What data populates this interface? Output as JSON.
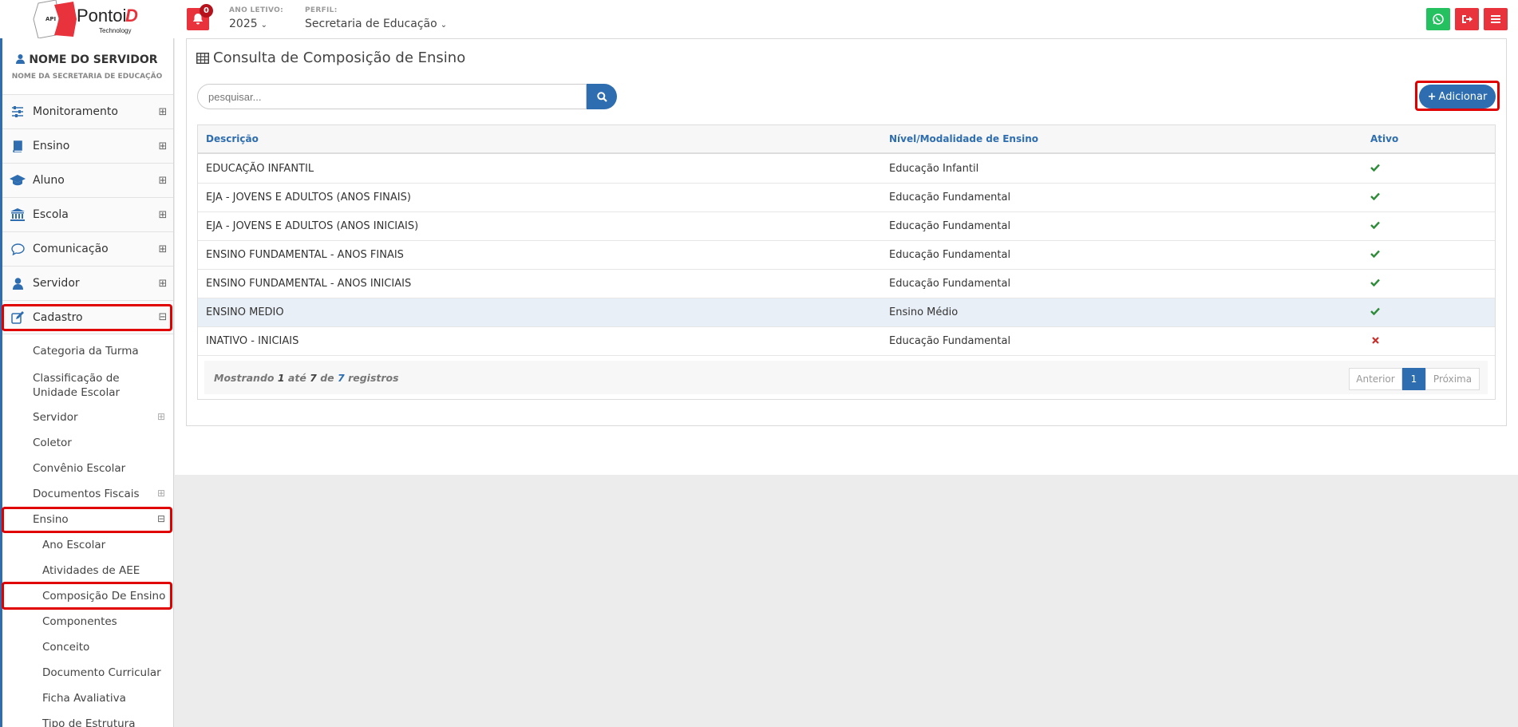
{
  "header": {
    "logo_text": "PontoiD",
    "logo_sub": "Technology",
    "logo_api": "API",
    "notifications_count": "0",
    "ano_letivo_label": "ANO LETIVO:",
    "ano_letivo_value": "2025",
    "perfil_label": "PERFIL:",
    "perfil_value": "Secretaria de Educação",
    "colors": {
      "whatsapp": "#25c160",
      "logout": "#e8323c",
      "menu": "#e8323c"
    }
  },
  "sidebar": {
    "user_name": "NOME DO SERVIDOR",
    "user_sub": "NOME DA SECRETARIA DE EDUCAÇÃO",
    "items": [
      {
        "label": "Monitoramento",
        "icon": "sliders-icon"
      },
      {
        "label": "Ensino",
        "icon": "book-icon"
      },
      {
        "label": "Aluno",
        "icon": "graduation-cap-icon"
      },
      {
        "label": "Escola",
        "icon": "institution-icon"
      },
      {
        "label": "Comunicação",
        "icon": "chat-bubble-icon"
      },
      {
        "label": "Servidor",
        "icon": "user-icon"
      },
      {
        "label": "Cadastro",
        "icon": "edit-icon"
      }
    ],
    "cadastro_sub": [
      "Categoria da Turma",
      "Classificação de Unidade Escolar",
      "Servidor",
      "Coletor",
      "Convênio Escolar",
      "Documentos Fiscais",
      "Ensino"
    ],
    "ensino_sub": [
      "Ano Escolar",
      "Atividades de AEE",
      "Composição De Ensino",
      "Componentes",
      "Conceito",
      "Documento Curricular",
      "Ficha Avaliativa",
      "Tipo de Estrutura"
    ]
  },
  "main": {
    "title": "Consulta de Composição de Ensino",
    "search_placeholder": "pesquisar...",
    "add_label": "Adicionar",
    "columns": [
      "Descrição",
      "Nível/Modalidade de Ensino",
      "Ativo"
    ],
    "rows": [
      {
        "descricao": "EDUCAÇÃO INFANTIL",
        "nivel": "Educação Infantil",
        "ativo": true
      },
      {
        "descricao": "EJA - JOVENS E ADULTOS (ANOS FINAIS)",
        "nivel": "Educação Fundamental",
        "ativo": true
      },
      {
        "descricao": "EJA - JOVENS E ADULTOS (ANOS INICIAIS)",
        "nivel": "Educação Fundamental",
        "ativo": true
      },
      {
        "descricao": "ENSINO FUNDAMENTAL - ANOS FINAIS",
        "nivel": "Educação Fundamental",
        "ativo": true
      },
      {
        "descricao": "ENSINO FUNDAMENTAL - ANOS INICIAIS",
        "nivel": "Educação Fundamental",
        "ativo": true
      },
      {
        "descricao": "ENSINO MEDIO",
        "nivel": "Ensino Médio",
        "ativo": true
      },
      {
        "descricao": "INATIVO - INICIAIS",
        "nivel": "Educação Fundamental",
        "ativo": false
      }
    ],
    "footer": {
      "mostrando": "Mostrando",
      "from": "1",
      "ate": "até",
      "to": "7",
      "de": "de",
      "total": "7",
      "registros": "registros"
    },
    "pagination": {
      "prev": "Anterior",
      "page": "1",
      "next": "Próxima"
    }
  }
}
